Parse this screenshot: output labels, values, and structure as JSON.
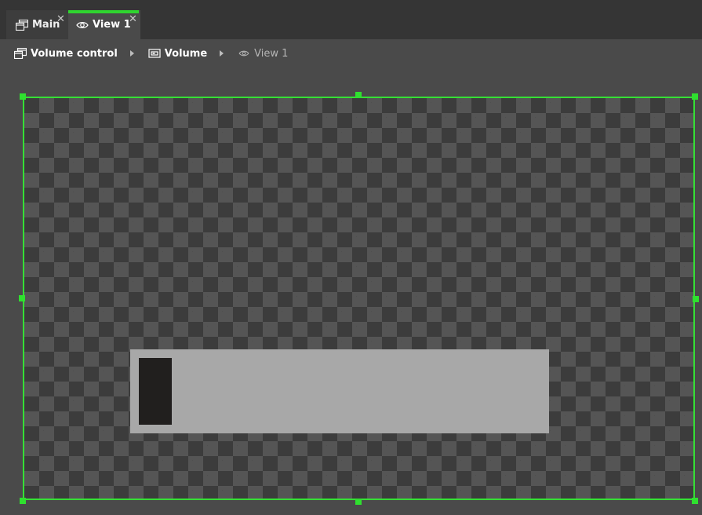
{
  "tabs": [
    {
      "label": "Main",
      "icon": "window-icon",
      "active": false
    },
    {
      "label": "View 1",
      "icon": "eye-icon",
      "active": true
    }
  ],
  "close_glyph": "✕",
  "breadcrumb": [
    {
      "label": "Volume control",
      "icon": "window-icon"
    },
    {
      "label": "Volume",
      "icon": "volume-widget-icon"
    },
    {
      "label": "View 1",
      "icon": "eye-icon"
    }
  ],
  "colors": {
    "accent": "#2fd52f",
    "background": "#4a4a4a",
    "tab_bar": "#353535",
    "track": "#a8a8a8",
    "thumb": "#211f1e"
  },
  "volume": {
    "level": 0
  }
}
